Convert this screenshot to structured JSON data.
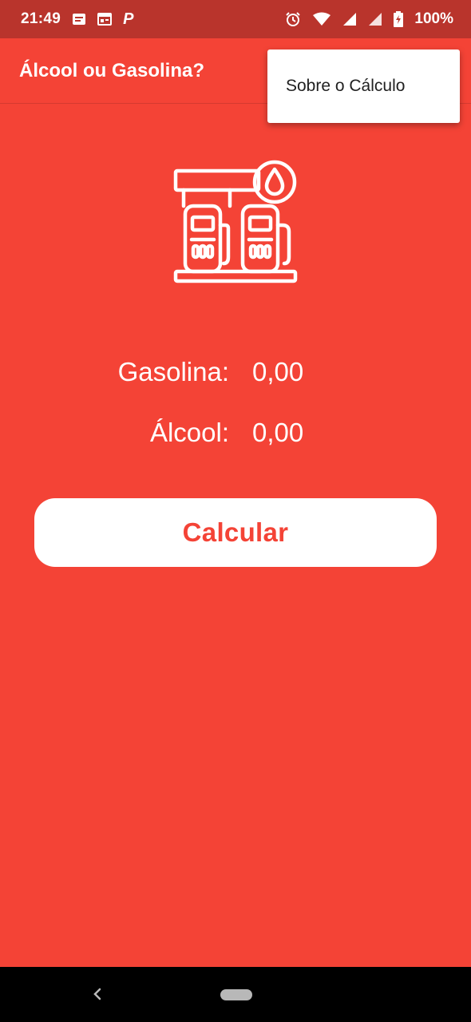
{
  "status_bar": {
    "time": "21:49",
    "battery_percent": "100%",
    "left_icons": [
      "notification-icon",
      "calendar-icon",
      "parking-icon"
    ],
    "right_icons": [
      "alarm-icon",
      "wifi-icon",
      "signal-icon",
      "signal-icon",
      "battery-charging-icon"
    ]
  },
  "app_bar": {
    "title": "Álcool ou Gasolina?"
  },
  "menu": {
    "items": [
      {
        "label": "Sobre o Cálculo"
      }
    ]
  },
  "illustration": {
    "icon": "fuel-pump-icon"
  },
  "fields": {
    "gasoline": {
      "label": "Gasolina:",
      "value": "0,00"
    },
    "alcohol": {
      "label": "Álcool:",
      "value": "0,00"
    }
  },
  "actions": {
    "calculate_label": "Calcular"
  },
  "colors": {
    "primary": "#f44336",
    "status_bar": "#b9342c",
    "button_bg": "#ffffff",
    "button_text": "#f44336",
    "nav_bar": "#000000"
  }
}
